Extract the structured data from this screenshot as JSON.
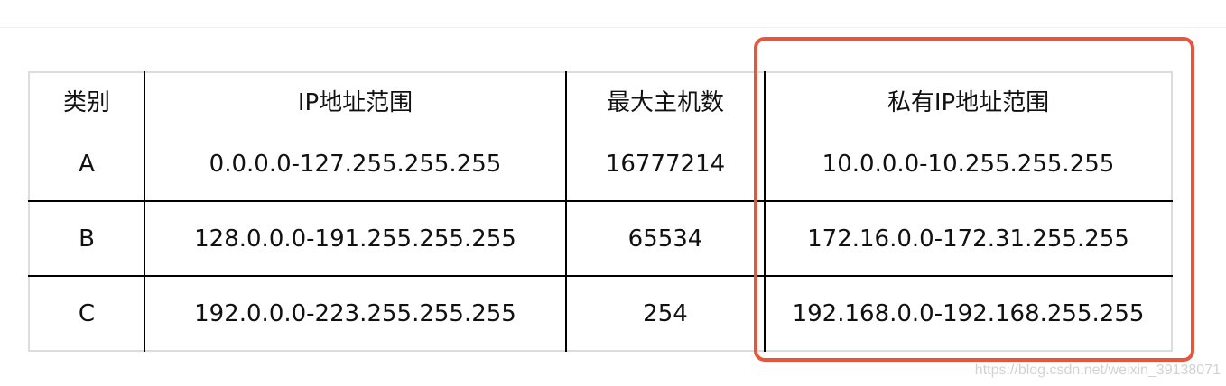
{
  "table": {
    "headers": [
      "类别",
      "IP地址范围",
      "最大主机数",
      "私有IP地址范围"
    ],
    "rows": [
      [
        "A",
        "0.0.0.0-127.255.255.255",
        "16777214",
        "10.0.0.0-10.255.255.255"
      ],
      [
        "B",
        "128.0.0.0-191.255.255.255",
        "65534",
        "172.16.0.0-172.31.255.255"
      ],
      [
        "C",
        "192.0.0.0-223.255.255.255",
        "254",
        "192.168.0.0-192.168.255.255"
      ]
    ]
  },
  "highlight": {
    "color": "#e8553b"
  },
  "watermark": "https://blog.csdn.net/weixin_39138071"
}
